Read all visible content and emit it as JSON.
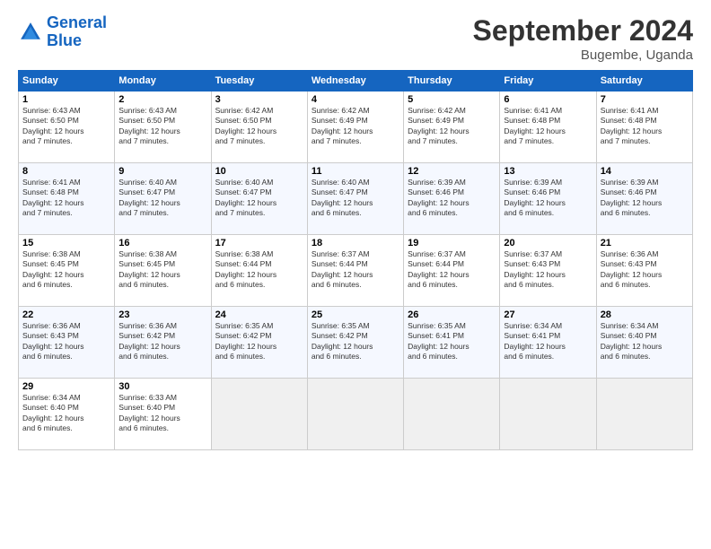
{
  "header": {
    "logo_line1": "General",
    "logo_line2": "Blue",
    "title": "September 2024",
    "subtitle": "Bugembe, Uganda"
  },
  "columns": [
    "Sunday",
    "Monday",
    "Tuesday",
    "Wednesday",
    "Thursday",
    "Friday",
    "Saturday"
  ],
  "weeks": [
    [
      {
        "day": "1",
        "lines": [
          "Sunrise: 6:43 AM",
          "Sunset: 6:50 PM",
          "Daylight: 12 hours",
          "and 7 minutes."
        ]
      },
      {
        "day": "2",
        "lines": [
          "Sunrise: 6:43 AM",
          "Sunset: 6:50 PM",
          "Daylight: 12 hours",
          "and 7 minutes."
        ]
      },
      {
        "day": "3",
        "lines": [
          "Sunrise: 6:42 AM",
          "Sunset: 6:50 PM",
          "Daylight: 12 hours",
          "and 7 minutes."
        ]
      },
      {
        "day": "4",
        "lines": [
          "Sunrise: 6:42 AM",
          "Sunset: 6:49 PM",
          "Daylight: 12 hours",
          "and 7 minutes."
        ]
      },
      {
        "day": "5",
        "lines": [
          "Sunrise: 6:42 AM",
          "Sunset: 6:49 PM",
          "Daylight: 12 hours",
          "and 7 minutes."
        ]
      },
      {
        "day": "6",
        "lines": [
          "Sunrise: 6:41 AM",
          "Sunset: 6:48 PM",
          "Daylight: 12 hours",
          "and 7 minutes."
        ]
      },
      {
        "day": "7",
        "lines": [
          "Sunrise: 6:41 AM",
          "Sunset: 6:48 PM",
          "Daylight: 12 hours",
          "and 7 minutes."
        ]
      }
    ],
    [
      {
        "day": "8",
        "lines": [
          "Sunrise: 6:41 AM",
          "Sunset: 6:48 PM",
          "Daylight: 12 hours",
          "and 7 minutes."
        ]
      },
      {
        "day": "9",
        "lines": [
          "Sunrise: 6:40 AM",
          "Sunset: 6:47 PM",
          "Daylight: 12 hours",
          "and 7 minutes."
        ]
      },
      {
        "day": "10",
        "lines": [
          "Sunrise: 6:40 AM",
          "Sunset: 6:47 PM",
          "Daylight: 12 hours",
          "and 7 minutes."
        ]
      },
      {
        "day": "11",
        "lines": [
          "Sunrise: 6:40 AM",
          "Sunset: 6:47 PM",
          "Daylight: 12 hours",
          "and 6 minutes."
        ]
      },
      {
        "day": "12",
        "lines": [
          "Sunrise: 6:39 AM",
          "Sunset: 6:46 PM",
          "Daylight: 12 hours",
          "and 6 minutes."
        ]
      },
      {
        "day": "13",
        "lines": [
          "Sunrise: 6:39 AM",
          "Sunset: 6:46 PM",
          "Daylight: 12 hours",
          "and 6 minutes."
        ]
      },
      {
        "day": "14",
        "lines": [
          "Sunrise: 6:39 AM",
          "Sunset: 6:46 PM",
          "Daylight: 12 hours",
          "and 6 minutes."
        ]
      }
    ],
    [
      {
        "day": "15",
        "lines": [
          "Sunrise: 6:38 AM",
          "Sunset: 6:45 PM",
          "Daylight: 12 hours",
          "and 6 minutes."
        ]
      },
      {
        "day": "16",
        "lines": [
          "Sunrise: 6:38 AM",
          "Sunset: 6:45 PM",
          "Daylight: 12 hours",
          "and 6 minutes."
        ]
      },
      {
        "day": "17",
        "lines": [
          "Sunrise: 6:38 AM",
          "Sunset: 6:44 PM",
          "Daylight: 12 hours",
          "and 6 minutes."
        ]
      },
      {
        "day": "18",
        "lines": [
          "Sunrise: 6:37 AM",
          "Sunset: 6:44 PM",
          "Daylight: 12 hours",
          "and 6 minutes."
        ]
      },
      {
        "day": "19",
        "lines": [
          "Sunrise: 6:37 AM",
          "Sunset: 6:44 PM",
          "Daylight: 12 hours",
          "and 6 minutes."
        ]
      },
      {
        "day": "20",
        "lines": [
          "Sunrise: 6:37 AM",
          "Sunset: 6:43 PM",
          "Daylight: 12 hours",
          "and 6 minutes."
        ]
      },
      {
        "day": "21",
        "lines": [
          "Sunrise: 6:36 AM",
          "Sunset: 6:43 PM",
          "Daylight: 12 hours",
          "and 6 minutes."
        ]
      }
    ],
    [
      {
        "day": "22",
        "lines": [
          "Sunrise: 6:36 AM",
          "Sunset: 6:43 PM",
          "Daylight: 12 hours",
          "and 6 minutes."
        ]
      },
      {
        "day": "23",
        "lines": [
          "Sunrise: 6:36 AM",
          "Sunset: 6:42 PM",
          "Daylight: 12 hours",
          "and 6 minutes."
        ]
      },
      {
        "day": "24",
        "lines": [
          "Sunrise: 6:35 AM",
          "Sunset: 6:42 PM",
          "Daylight: 12 hours",
          "and 6 minutes."
        ]
      },
      {
        "day": "25",
        "lines": [
          "Sunrise: 6:35 AM",
          "Sunset: 6:42 PM",
          "Daylight: 12 hours",
          "and 6 minutes."
        ]
      },
      {
        "day": "26",
        "lines": [
          "Sunrise: 6:35 AM",
          "Sunset: 6:41 PM",
          "Daylight: 12 hours",
          "and 6 minutes."
        ]
      },
      {
        "day": "27",
        "lines": [
          "Sunrise: 6:34 AM",
          "Sunset: 6:41 PM",
          "Daylight: 12 hours",
          "and 6 minutes."
        ]
      },
      {
        "day": "28",
        "lines": [
          "Sunrise: 6:34 AM",
          "Sunset: 6:40 PM",
          "Daylight: 12 hours",
          "and 6 minutes."
        ]
      }
    ],
    [
      {
        "day": "29",
        "lines": [
          "Sunrise: 6:34 AM",
          "Sunset: 6:40 PM",
          "Daylight: 12 hours",
          "and 6 minutes."
        ]
      },
      {
        "day": "30",
        "lines": [
          "Sunrise: 6:33 AM",
          "Sunset: 6:40 PM",
          "Daylight: 12 hours",
          "and 6 minutes."
        ]
      },
      {
        "day": "",
        "lines": []
      },
      {
        "day": "",
        "lines": []
      },
      {
        "day": "",
        "lines": []
      },
      {
        "day": "",
        "lines": []
      },
      {
        "day": "",
        "lines": []
      }
    ]
  ]
}
